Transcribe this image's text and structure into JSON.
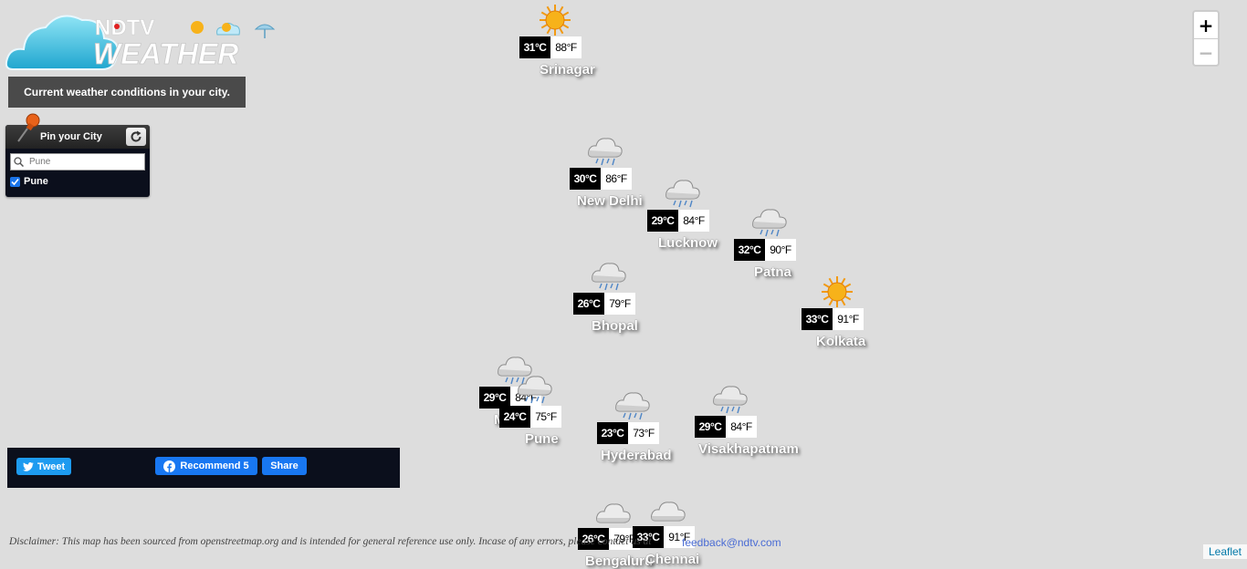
{
  "branding": {
    "logo_text_top": "NDTV",
    "logo_text_bottom": "WEATHER",
    "tagline": "Current weather conditions in your city."
  },
  "pin_panel": {
    "title": "Pin your City",
    "search_placeholder": "Pune",
    "checked_city": "Pune"
  },
  "share": {
    "tweet_label": "Tweet",
    "recommend_label": "Recommend 5",
    "share_label": "Share"
  },
  "zoom": {
    "in_label": "+",
    "out_label": "−"
  },
  "footer": {
    "disclaimer": "Disclaimer: This map has been sourced from openstreetmap.org and is intended for general reference use only. Incase of any errors, please contact us at",
    "feedback_email": "feedback@ndtv.com",
    "attribution": "Leaflet"
  },
  "cities": [
    {
      "name": "Srinagar",
      "celsius": "31°C",
      "fahrenheit": "88°F",
      "condition": "sunny-icon"
    },
    {
      "name": "New Delhi",
      "celsius": "30°C",
      "fahrenheit": "86°F",
      "condition": "rain-cloud-icon"
    },
    {
      "name": "Lucknow",
      "celsius": "29°C",
      "fahrenheit": "84°F",
      "condition": "rain-cloud-icon"
    },
    {
      "name": "Patna",
      "celsius": "32°C",
      "fahrenheit": "90°F",
      "condition": "rain-cloud-icon"
    },
    {
      "name": "Bhopal",
      "celsius": "26°C",
      "fahrenheit": "79°F",
      "condition": "rain-cloud-icon"
    },
    {
      "name": "Kolkata",
      "celsius": "33°C",
      "fahrenheit": "91°F",
      "condition": "sunny-icon"
    },
    {
      "name": "Mumbai",
      "celsius": "29°C",
      "fahrenheit": "84°F",
      "condition": "rain-cloud-icon"
    },
    {
      "name": "Pune",
      "celsius": "24°C",
      "fahrenheit": "75°F",
      "condition": "rain-cloud-icon"
    },
    {
      "name": "Hyderabad",
      "celsius": "23°C",
      "fahrenheit": "73°F",
      "condition": "rain-cloud-icon"
    },
    {
      "name": "Visakhapatnam",
      "celsius": "29°C",
      "fahrenheit": "84°F",
      "condition": "rain-cloud-icon"
    },
    {
      "name": "Bengaluru",
      "celsius": "26°C",
      "fahrenheit": "79°F",
      "condition": "cloudy-icon"
    },
    {
      "name": "Chennai",
      "celsius": "33°C",
      "fahrenheit": "91°F",
      "condition": "cloudy-icon"
    }
  ]
}
